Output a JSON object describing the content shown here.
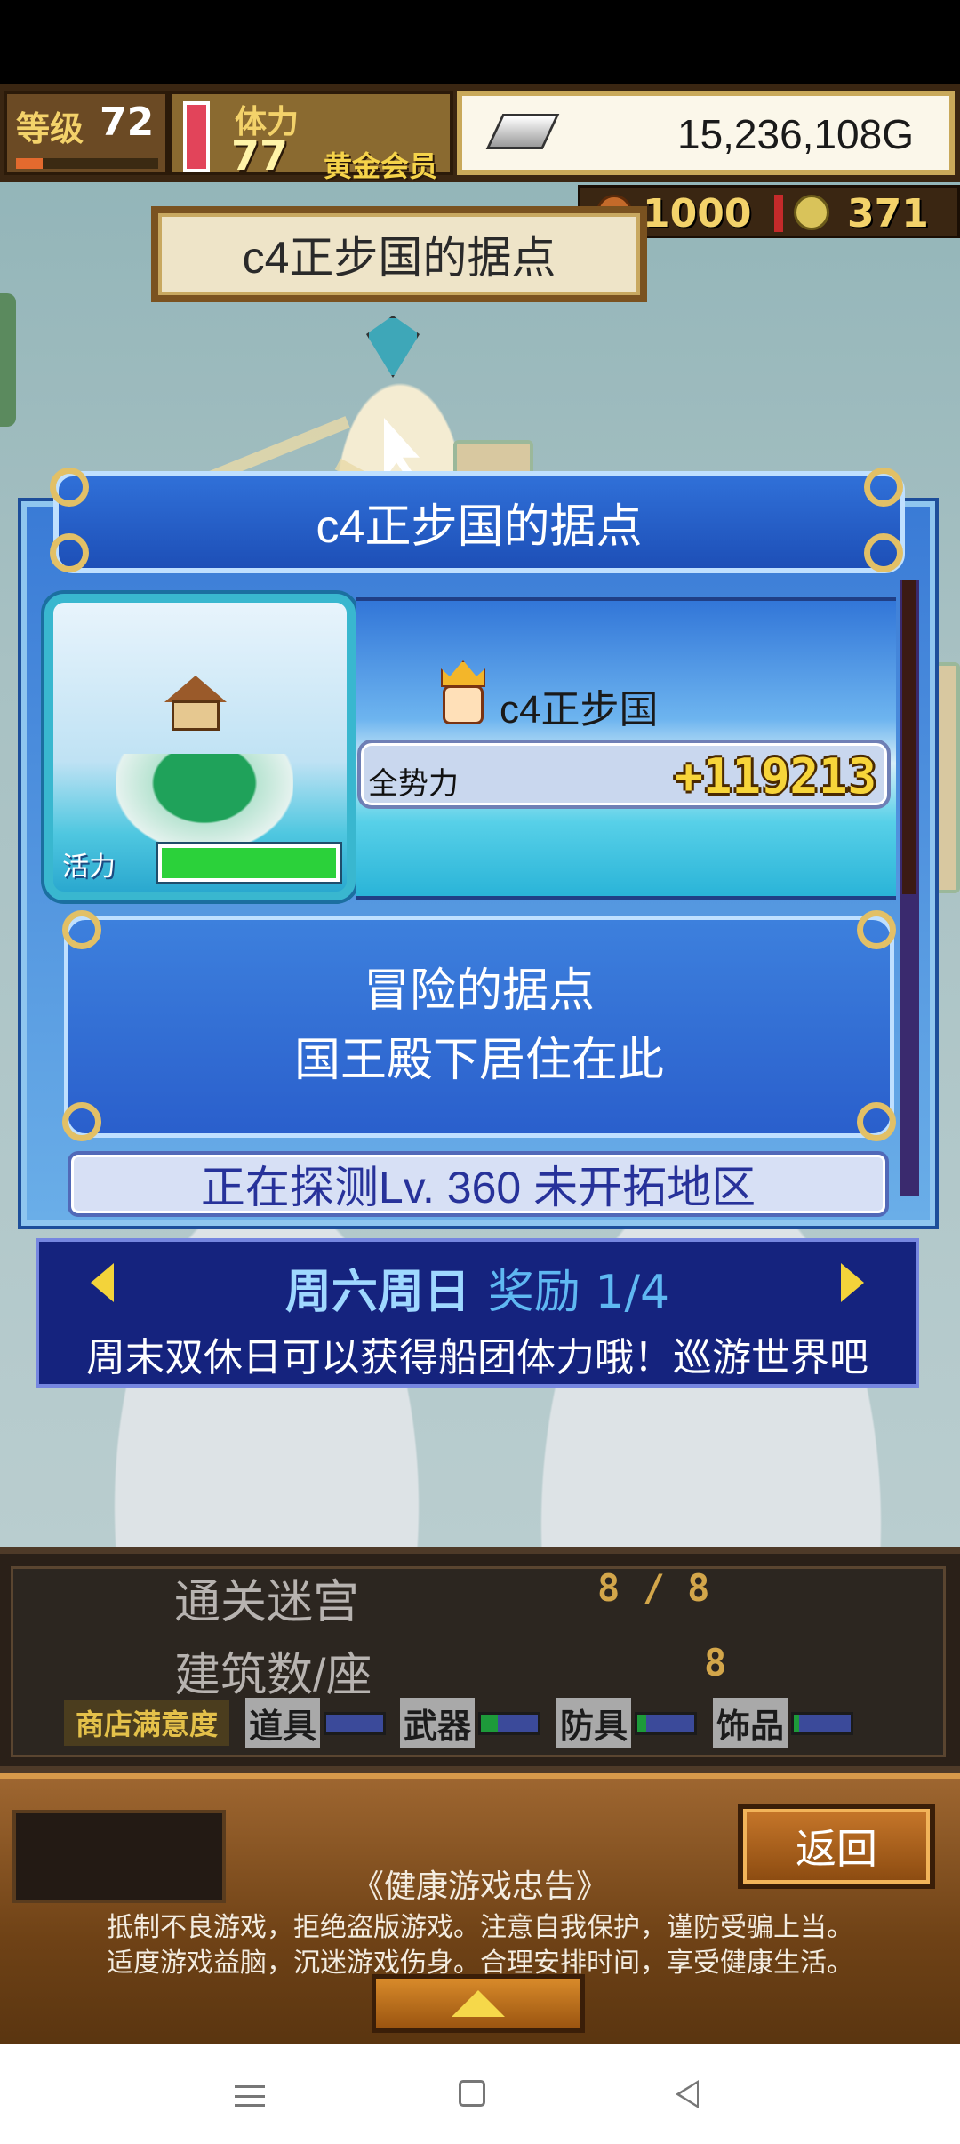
{
  "hud": {
    "level_label": "等级",
    "level": "72",
    "stamina_label": "体力",
    "stamina": "77",
    "vip_label": "黄金会员",
    "gold": "15,236,108G",
    "resource1": "1000",
    "resource2": "371"
  },
  "map": {
    "location_name": "c4正步国的据点"
  },
  "dialog": {
    "title": "c4正步国的据点",
    "vitality_label": "活力",
    "vitality_level": 1.0,
    "owner_name": "c4正步国",
    "power_label": "全势力",
    "power_value": "+119213",
    "description_line1": "冒险的据点",
    "description_line2": "国王殿下居住在此",
    "explore_text": "正在探测Lv. 360 未开拓地区"
  },
  "banner": {
    "title": "周六周日",
    "reward": "奖励 1/4",
    "message": "周末双休日可以获得船团体力哦！巡游世界吧"
  },
  "stats": {
    "dungeons_label": "通关迷宫",
    "dungeons_value": "8 / 8",
    "buildings_label": "建筑数/座",
    "buildings_value": "8",
    "shop_satisfaction_label": "商店满意度",
    "shop_items": [
      {
        "label": "道具",
        "level": 0.0
      },
      {
        "label": "武器",
        "level": 0.3
      },
      {
        "label": "防具",
        "level": 0.15
      },
      {
        "label": "饰品",
        "level": 0.1
      }
    ]
  },
  "footer": {
    "back_label": "返回",
    "notice_title": "《健康游戏忠告》",
    "notice_line1": "抵制不良游戏，拒绝盗版游戏。注意自我保护，谨防受骗上当。",
    "notice_line2": "适度游戏益脑，沉迷游戏伤身。合理安排时间，享受健康生活。"
  },
  "colors": {
    "dialog_blue": "#2a5fcc",
    "gold_text": "#f7d53a",
    "vitality_green": "#2bd13a"
  }
}
